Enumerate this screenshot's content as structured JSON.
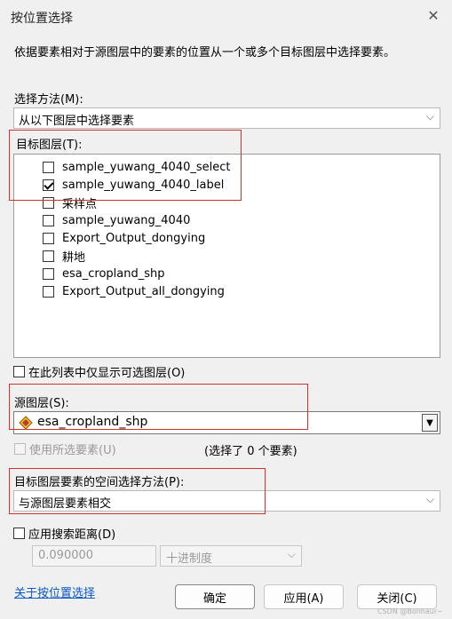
{
  "window": {
    "title": "按位置选择",
    "close_glyph": "✕",
    "description": "依据要素相对于源图层中的要素的位置从一个或多个目标图层中选择要素。"
  },
  "selection_method": {
    "label": "选择方法(M):",
    "value": "从以下图层中选择要素",
    "arrow": "⌵"
  },
  "target_layers": {
    "label": "目标图层(T):",
    "items": [
      {
        "label": "sample_yuwang_4040_select",
        "checked": false
      },
      {
        "label": "sample_yuwang_4040_label",
        "checked": true
      },
      {
        "label": "采样点",
        "checked": false
      },
      {
        "label": "sample_yuwang_4040",
        "checked": false
      },
      {
        "label": "Export_Output_dongying",
        "checked": false
      },
      {
        "label": "耕地",
        "checked": false
      },
      {
        "label": "esa_cropland_shp",
        "checked": false
      },
      {
        "label": "Export_Output_all_dongying",
        "checked": false
      }
    ],
    "only_selectable_label": "在此列表中仅显示可选图层(O)"
  },
  "source_layer": {
    "label": "源图层(S):",
    "value": "esa_cropland_shp",
    "arrow": "▼",
    "use_selected_label": "使用所选要素(U)",
    "selected_count_text": "(选择了 0 个要素)"
  },
  "spatial_method": {
    "label": "目标图层要素的空间选择方法(P):",
    "value": "与源图层要素相交",
    "arrow": "⌵"
  },
  "search_distance": {
    "label": "应用搜索距离(D)",
    "value": "0.090000",
    "unit": "十进制度",
    "arrow": "⌵"
  },
  "footer": {
    "help_link": "关于按位置选择",
    "ok": "确定",
    "apply": "应用(A)",
    "close": "关闭(C)",
    "watermark": "CSDN @Bonhaur~"
  },
  "colors": {
    "highlight_border": "#d0322f",
    "link": "#0a58c7"
  }
}
